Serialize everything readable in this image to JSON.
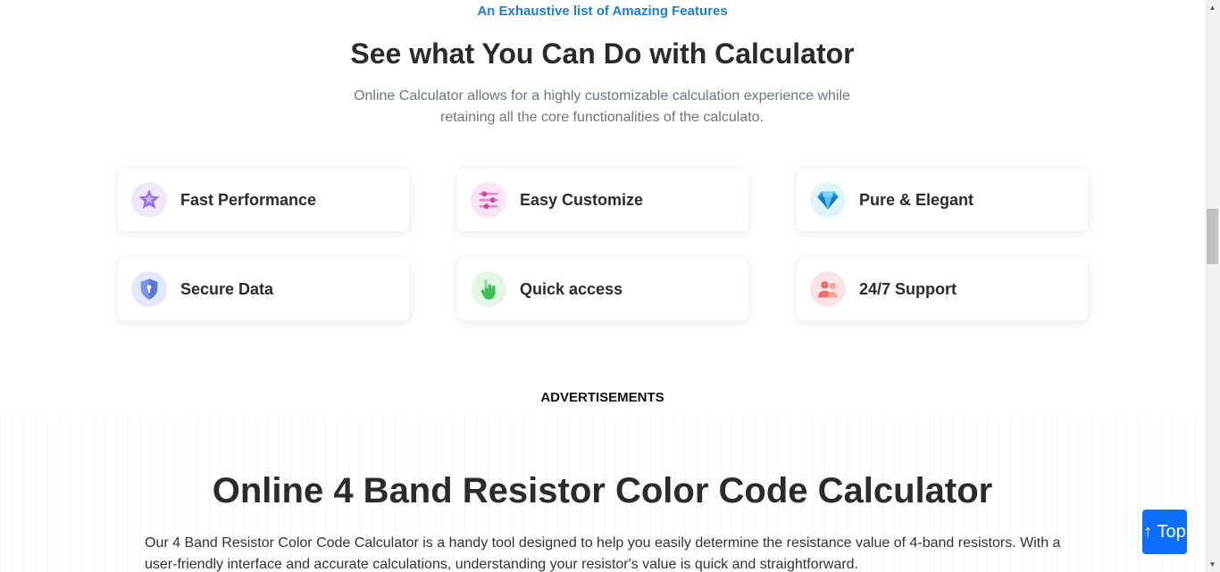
{
  "features_section": {
    "eyebrow": "An Exhaustive list of Amazing Features",
    "title": "See what You Can Do with Calculator",
    "description": "Online Calculator allows for a highly customizable calculation experience while retaining all the core functionalities of the calculato.",
    "items": [
      {
        "label": "Fast Performance",
        "icon": "star-icon"
      },
      {
        "label": "Easy Customize",
        "icon": "sliders-icon"
      },
      {
        "label": "Pure & Elegant",
        "icon": "diamond-icon"
      },
      {
        "label": "Secure Data",
        "icon": "shield-icon"
      },
      {
        "label": "Quick access",
        "icon": "pointer-hand-icon"
      },
      {
        "label": "24/7 Support",
        "icon": "support-people-icon"
      }
    ]
  },
  "ads": {
    "label": "ADVERTISEMENTS"
  },
  "calculator_intro": {
    "title": "Online 4 Band Resistor Color Code Calculator",
    "description": "Our 4 Band Resistor Color Code Calculator is a handy tool designed to help you easily determine the resistance value of 4-band resistors. With a user-friendly interface and accurate calculations, understanding your resistor's value is quick and straightforward."
  },
  "back_to_top": {
    "label": "↑ Top"
  },
  "colors": {
    "accent": "#1c7ed6",
    "button": "#0d6efd"
  }
}
